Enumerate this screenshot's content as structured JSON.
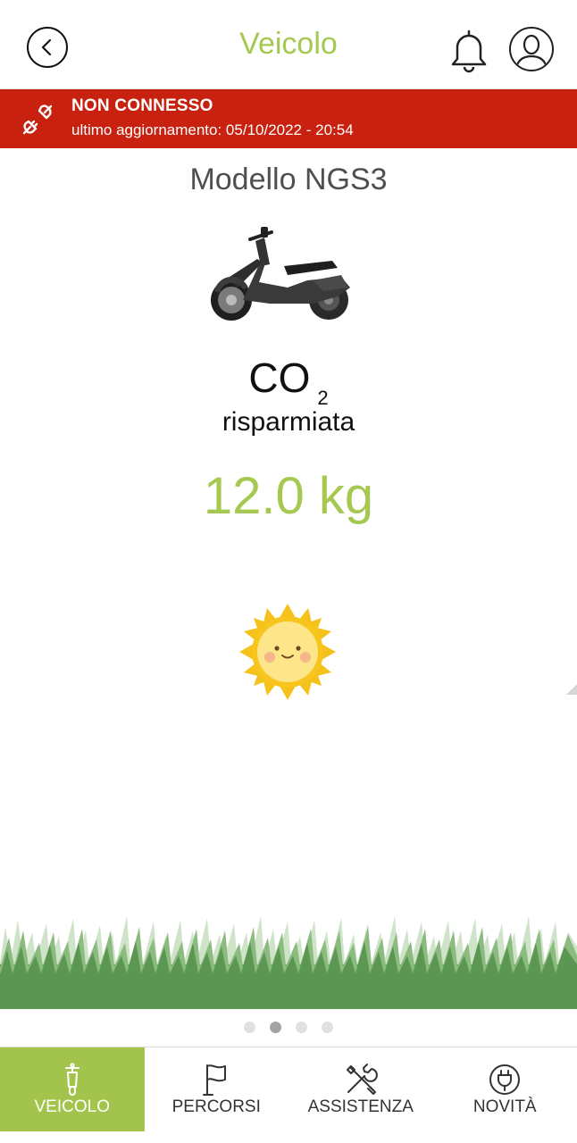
{
  "header": {
    "title": "Veicolo"
  },
  "status": {
    "label": "NON CONNESSO",
    "last_update": "ultimo aggiornamento: 05/10/2022 - 20:54",
    "color": "#c8210f"
  },
  "vehicle": {
    "model": "Modello NGS3"
  },
  "co2": {
    "symbol": "CO",
    "subscript": "2",
    "caption": "risparmiata",
    "amount": "12.0 kg"
  },
  "pager": {
    "count": 4,
    "active_index": 1
  },
  "nav": {
    "items": [
      {
        "label": "VEICOLO",
        "icon": "scooter-icon"
      },
      {
        "label": "PERCORSI",
        "icon": "flag-icon"
      },
      {
        "label": "ASSISTENZA",
        "icon": "tools-icon"
      },
      {
        "label": "NOVITÀ",
        "icon": "plug-icon"
      }
    ],
    "active_index": 0
  },
  "colors": {
    "accent": "#a5c850",
    "nav_active": "#a3c44c",
    "alert": "#c8210f"
  }
}
